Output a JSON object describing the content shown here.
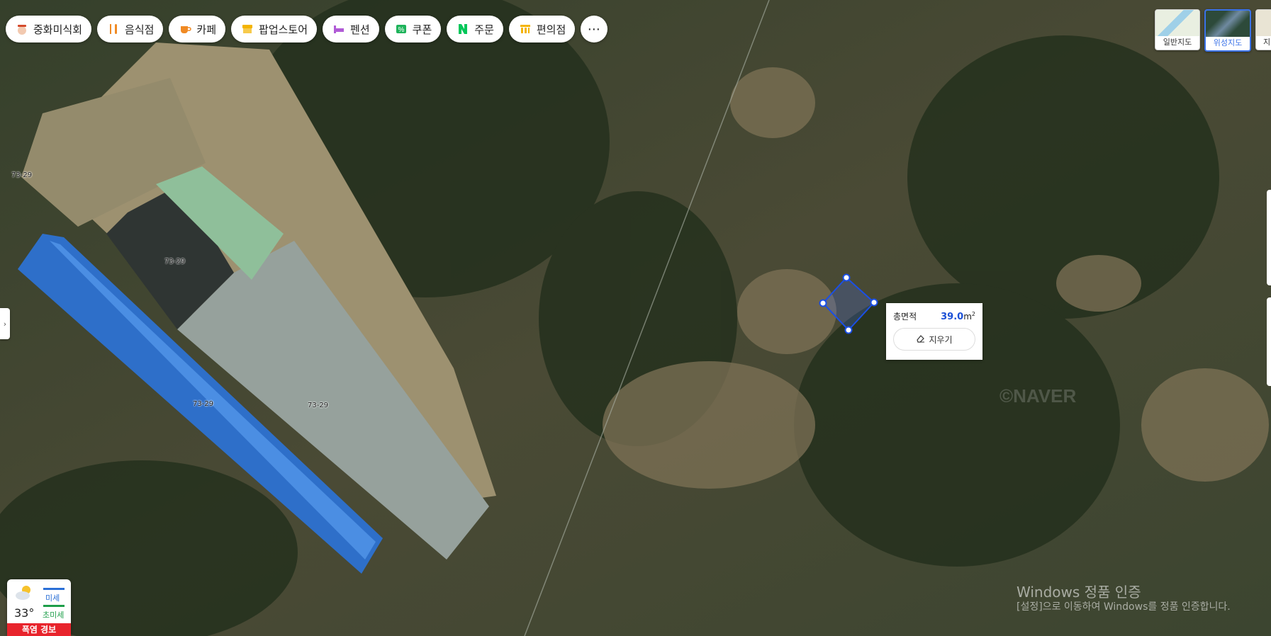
{
  "categories": [
    {
      "label": "중화미식회",
      "icon": "chinese-food-icon"
    },
    {
      "label": "음식점",
      "icon": "restaurant-icon"
    },
    {
      "label": "카페",
      "icon": "cafe-icon"
    },
    {
      "label": "팝업스토어",
      "icon": "popup-store-icon"
    },
    {
      "label": "펜션",
      "icon": "pension-icon"
    },
    {
      "label": "쿠폰",
      "icon": "coupon-icon"
    },
    {
      "label": "주문",
      "icon": "naver-order-icon"
    },
    {
      "label": "편의점",
      "icon": "convenience-store-icon"
    }
  ],
  "more_label": "⋯",
  "map_types": {
    "normal": "일반지도",
    "satellite": "위성지도",
    "cadastral": "지",
    "active": "satellite"
  },
  "parcel_labels": [
    "73-29",
    "73-29",
    "73-29",
    "73-29"
  ],
  "area_popup": {
    "label": "총면적",
    "value": "39.0",
    "unit": "m",
    "unit_sup": "2",
    "delete_label": "지우기"
  },
  "weather": {
    "temperature": "33°",
    "fine_dust": "미세",
    "ultra_fine_dust": "초미세",
    "alert": "폭염 경보"
  },
  "watermark": {
    "brand": "©NAVER",
    "line1": "Windows 정품 인증",
    "line2": "[설정]으로 이동하여 Windows를 정품 인증합니다."
  },
  "colors": {
    "accent": "#1a4fd6",
    "alert_red": "#e8242c",
    "dust_blue": "#2a6fd6",
    "dust_green": "#1e9e4a"
  }
}
